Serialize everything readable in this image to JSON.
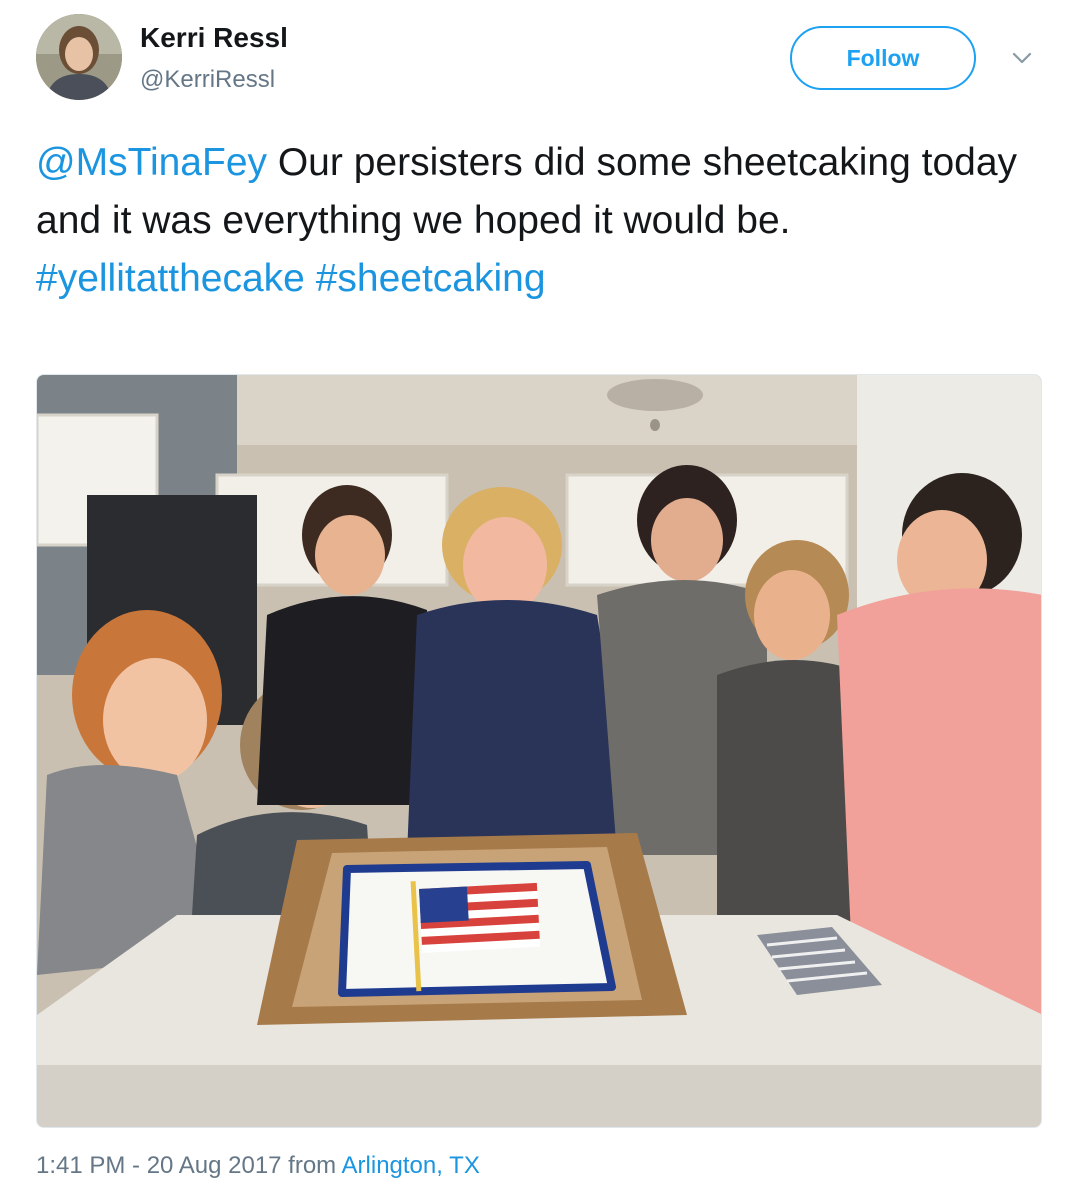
{
  "user": {
    "name": "Kerri Ressl",
    "handle": "@KerriRessl",
    "follow_label": "Follow"
  },
  "tweet": {
    "mention": "@MsTinaFey",
    "body": " Our persisters did some sheetcaking today and it was everything we hoped it would be. ",
    "hashtag1": "#yellitatthecake",
    "hashtag2": "#sheetcaking"
  },
  "meta": {
    "time_date": "1:41 PM - 20 Aug 2017 from ",
    "location": "Arlington, TX"
  },
  "colors": {
    "link": "#1b95e0",
    "follow_border": "#1da1f2",
    "secondary_text": "#657786"
  },
  "icons": {
    "menu": "chevron-down-icon"
  }
}
